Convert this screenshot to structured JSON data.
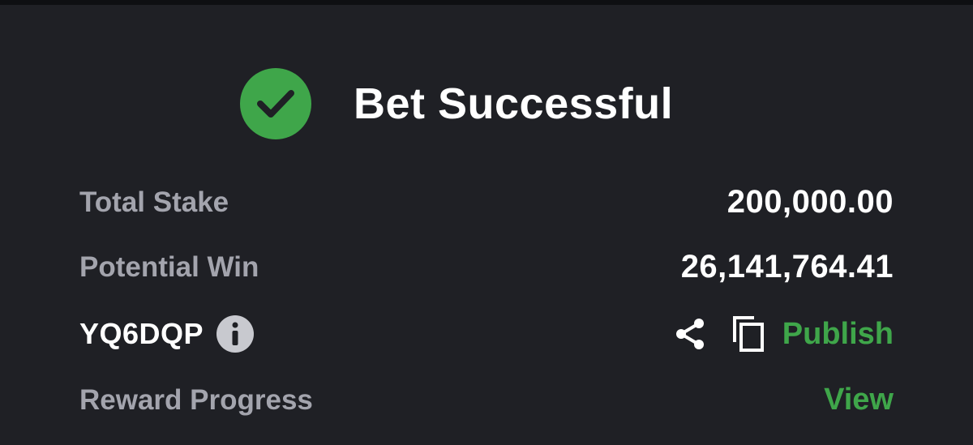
{
  "header": {
    "status_icon": "check-circle-icon",
    "title": "Bet Successful"
  },
  "summary": {
    "total_stake_label": "Total Stake",
    "total_stake_value": "200,000.00",
    "potential_win_label": "Potential Win",
    "potential_win_value": "26,141,764.41"
  },
  "booking": {
    "code": "YQ6DQP",
    "info_icon": "info-icon",
    "share_icon": "share-icon",
    "copy_icon": "copy-icon",
    "publish_label": "Publish"
  },
  "reward": {
    "label": "Reward Progress",
    "view_label": "View"
  },
  "colors": {
    "background": "#1f2025",
    "accent_green": "#3fa64a",
    "label_gray": "#a3a4ad",
    "text_white": "#ffffff"
  }
}
